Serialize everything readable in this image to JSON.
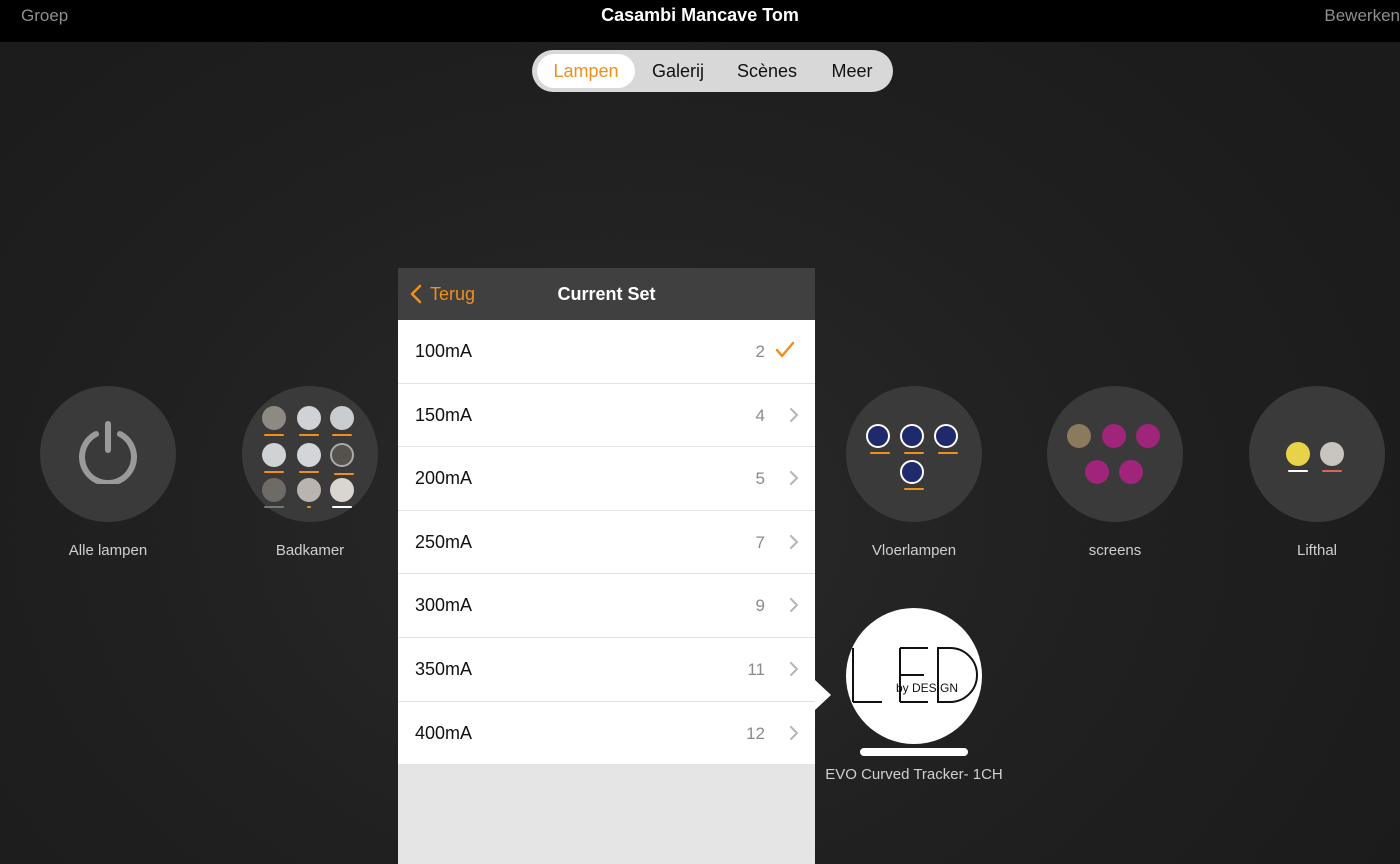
{
  "topbar": {
    "left": "Groep",
    "title": "Casambi Mancave Tom",
    "right": "Bewerken"
  },
  "tabs": [
    {
      "label": "Lampen",
      "active": true
    },
    {
      "label": "Galerij",
      "active": false
    },
    {
      "label": "Scènes",
      "active": false
    },
    {
      "label": "Meer",
      "active": false
    }
  ],
  "groups": [
    {
      "label": "Alle lampen",
      "icon": "power-icon"
    },
    {
      "label": "Badkamer",
      "icon": "lamp-thumbnails"
    },
    {
      "label": "Vloerlampen",
      "icon": "rp-logo-thumbnails"
    },
    {
      "label": "screens",
      "icon": "screen-thumbnails"
    },
    {
      "label": "Lifthal",
      "icon": "lamp-thumbnails"
    }
  ],
  "popover": {
    "back_label": "Terug",
    "title": "Current Set",
    "rows": [
      {
        "label": "100mA",
        "count": "2",
        "selected": true
      },
      {
        "label": "150mA",
        "count": "4",
        "selected": false
      },
      {
        "label": "200mA",
        "count": "5",
        "selected": false
      },
      {
        "label": "250mA",
        "count": "7",
        "selected": false
      },
      {
        "label": "300mA",
        "count": "9",
        "selected": false
      },
      {
        "label": "350mA",
        "count": "11",
        "selected": false
      },
      {
        "label": "400mA",
        "count": "12",
        "selected": false
      }
    ]
  },
  "selected_lamp": {
    "label": "EVO Curved Tracker- 1CH",
    "logo_main": "LED",
    "logo_sub": "by DESIGN"
  },
  "colors": {
    "accent": "#f0901b",
    "background": "#1e1e1e",
    "topbar": "#000000"
  }
}
